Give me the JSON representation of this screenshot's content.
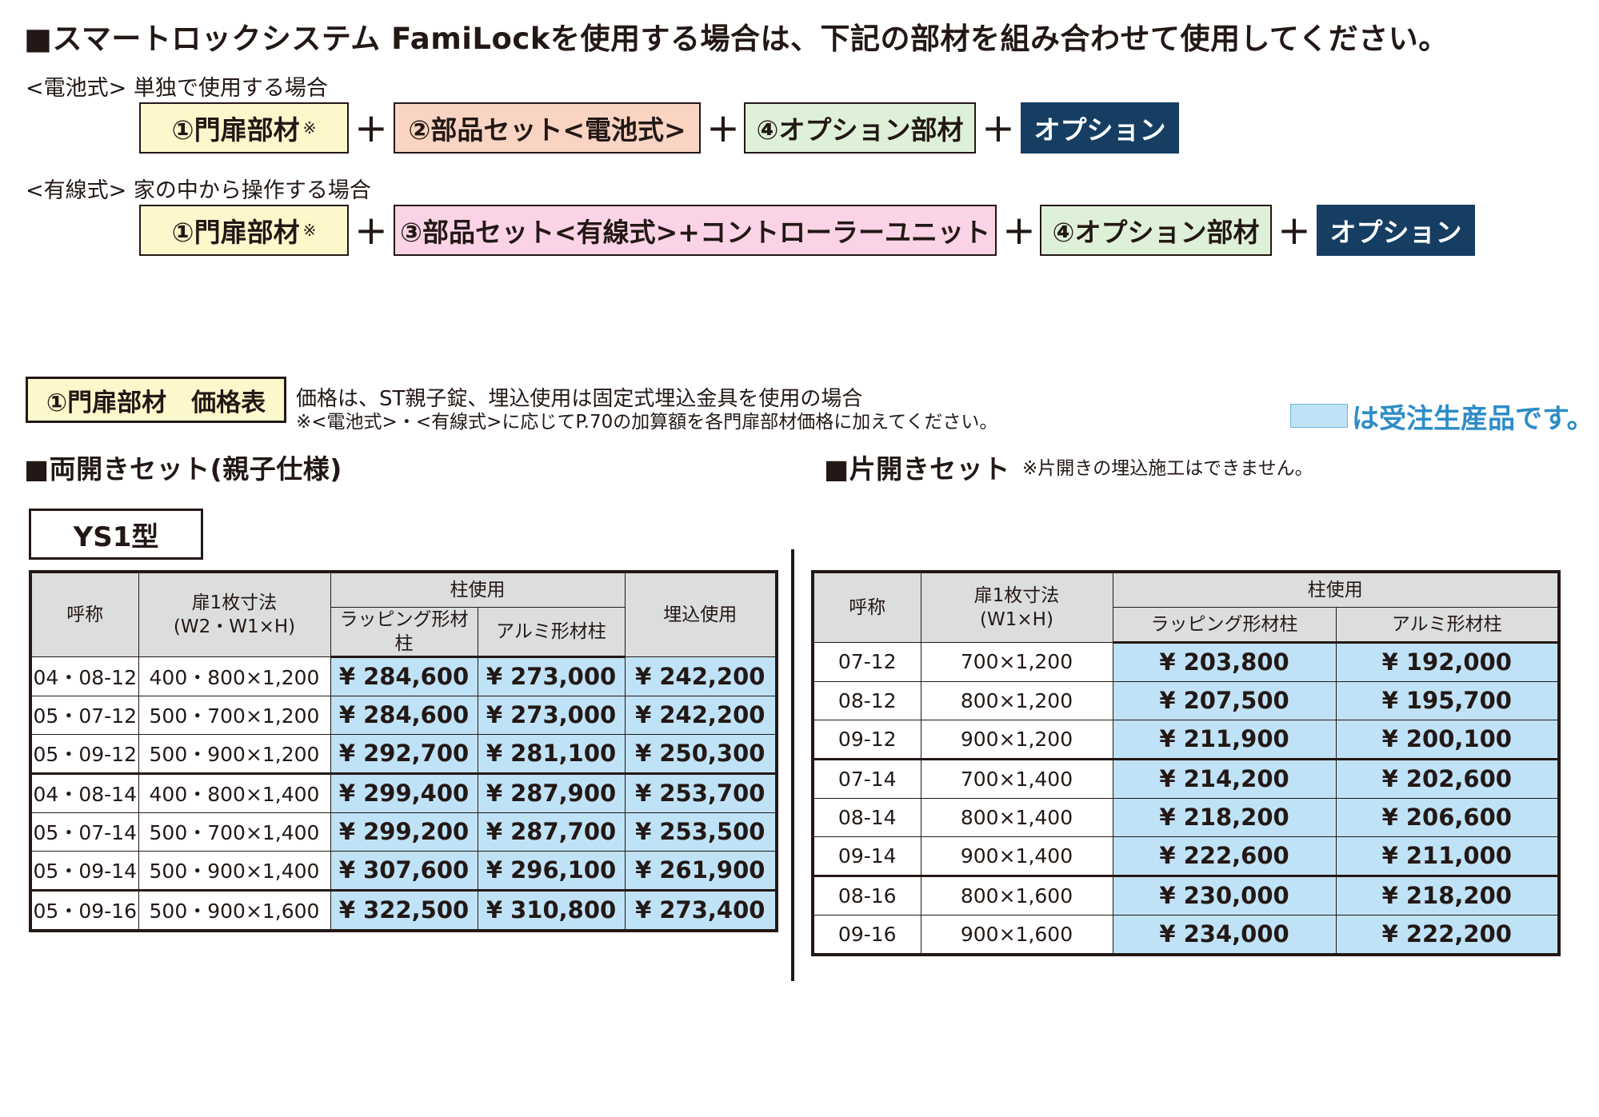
{
  "header": {
    "title": "■スマートロックシステム FamiLockを使用する場合は、下記の部材を組み合わせて使用してください。"
  },
  "combos": {
    "battery": {
      "label": "<電池式> 単独で使用する場合",
      "door": "①門扉部材",
      "note_mark": "※",
      "parts": "②部品セット<電池式>",
      "opt4": "④オプション部材",
      "option": "オプション"
    },
    "wired": {
      "label": "<有線式> 家の中から操作する場合",
      "door": "①門扉部材",
      "note_mark": "※",
      "parts": "③部品セット<有線式>+コントローラーユニット",
      "opt4": "④オプション部材",
      "option": "オプション"
    },
    "plus": "+"
  },
  "price_section": {
    "title": "①門扉部材　価格表",
    "note1": "価格は、ST親子錠、埋込使用は固定式埋込金具を使用の場合",
    "note2": "※<電池式>・<有線式>に応じてP.70の加算額を各門扉部材価格に加えてください。",
    "legend": "は受注生産品です。"
  },
  "double_set": {
    "title": "■両開きセット(親子仕様)",
    "model": "YS1型",
    "headers": {
      "name": "呼称",
      "size": "扉1枚寸法",
      "size_sub": "(W2・W1×H)",
      "pillar": "柱使用",
      "wrap": "ラッピング形材柱",
      "alu": "アルミ形材柱",
      "embed": "埋込使用"
    },
    "rows": [
      {
        "name": "04・08-12",
        "size": "400・800×1,200",
        "wrap": "¥ 284,600",
        "alu": "¥ 273,000",
        "embed": "¥ 242,200"
      },
      {
        "name": "05・07-12",
        "size": "500・700×1,200",
        "wrap": "¥ 284,600",
        "alu": "¥ 273,000",
        "embed": "¥ 242,200"
      },
      {
        "name": "05・09-12",
        "size": "500・900×1,200",
        "wrap": "¥ 292,700",
        "alu": "¥ 281,100",
        "embed": "¥ 250,300"
      },
      {
        "name": "04・08-14",
        "size": "400・800×1,400",
        "wrap": "¥ 299,400",
        "alu": "¥ 287,900",
        "embed": "¥ 253,700"
      },
      {
        "name": "05・07-14",
        "size": "500・700×1,400",
        "wrap": "¥ 299,200",
        "alu": "¥ 287,700",
        "embed": "¥ 253,500"
      },
      {
        "name": "05・09-14",
        "size": "500・900×1,400",
        "wrap": "¥ 307,600",
        "alu": "¥ 296,100",
        "embed": "¥ 261,900"
      },
      {
        "name": "05・09-16",
        "size": "500・900×1,600",
        "wrap": "¥ 322,500",
        "alu": "¥ 310,800",
        "embed": "¥ 273,400"
      }
    ]
  },
  "single_set": {
    "title": "■片開きセット",
    "note": "※片開きの埋込施工はできません。",
    "headers": {
      "name": "呼称",
      "size": "扉1枚寸法",
      "size_sub": "(W1×H)",
      "pillar": "柱使用",
      "wrap": "ラッピング形材柱",
      "alu": "アルミ形材柱"
    },
    "rows": [
      {
        "name": "07-12",
        "size": "700×1,200",
        "wrap": "¥ 203,800",
        "alu": "¥ 192,000"
      },
      {
        "name": "08-12",
        "size": "800×1,200",
        "wrap": "¥ 207,500",
        "alu": "¥ 195,700"
      },
      {
        "name": "09-12",
        "size": "900×1,200",
        "wrap": "¥ 211,900",
        "alu": "¥ 200,100"
      },
      {
        "name": "07-14",
        "size": "700×1,400",
        "wrap": "¥ 214,200",
        "alu": "¥ 202,600"
      },
      {
        "name": "08-14",
        "size": "800×1,400",
        "wrap": "¥ 218,200",
        "alu": "¥ 206,600"
      },
      {
        "name": "09-14",
        "size": "900×1,400",
        "wrap": "¥ 222,600",
        "alu": "¥ 211,000"
      },
      {
        "name": "08-16",
        "size": "800×1,600",
        "wrap": "¥ 230,000",
        "alu": "¥ 218,200"
      },
      {
        "name": "09-16",
        "size": "900×1,600",
        "wrap": "¥ 234,000",
        "alu": "¥ 222,200"
      }
    ]
  },
  "colors": {
    "made_to_order": "#bfe2f6",
    "option_navy": "#163e63",
    "door_yellow": "#fdf7cc",
    "battery_salmon": "#f9d4c2",
    "opt4_green": "#dff0d8",
    "wired_pink": "#fad3e6"
  }
}
